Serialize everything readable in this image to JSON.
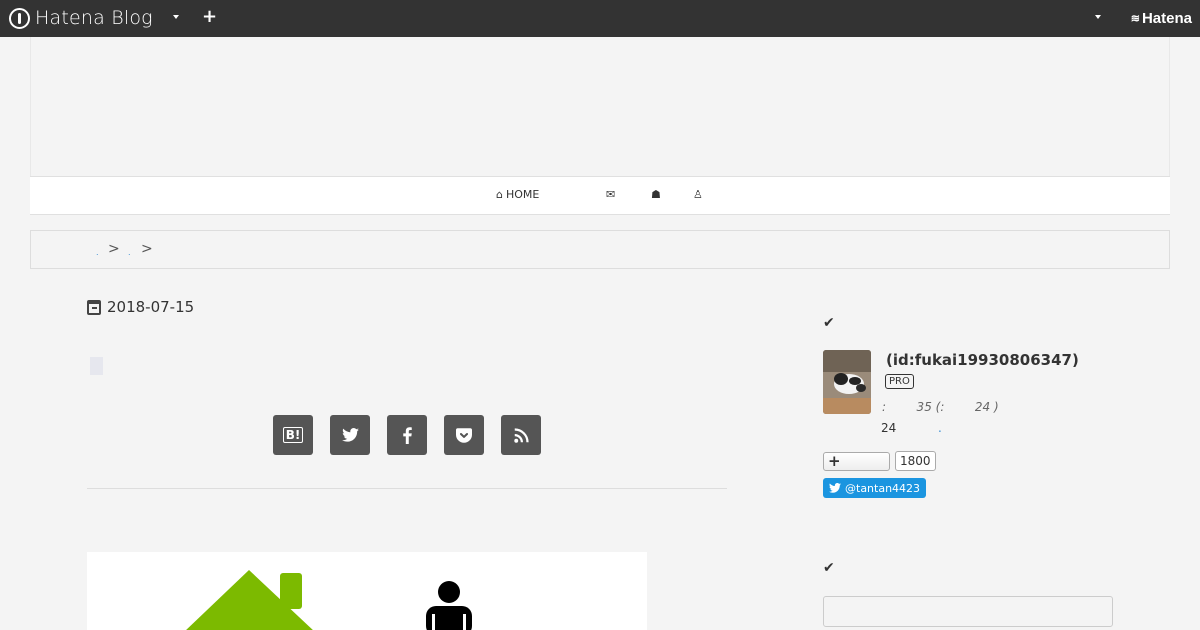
{
  "topbar": {
    "logo_text": "Hatena Blog",
    "add_label": "+",
    "brand_text": "Hatena",
    "brand_mark": "≋"
  },
  "nav": {
    "home_icon": "⌂",
    "home_label": "HOME",
    "mail_icon": "✉",
    "user_icon": "☗",
    "person_icon": "♙"
  },
  "breadcrumb": {
    "link1": ".",
    "sep1": ">",
    "link2": ".",
    "sep2": ">"
  },
  "entry": {
    "date": "2018-07-15"
  },
  "share": {
    "hatebu_label": "B!"
  },
  "sidebar": {
    "section1_check": "✔",
    "profile_name": "(id:fukai19930806347)",
    "pro_badge": "PRO",
    "stats_text": ":        35 (:        24 )",
    "count_text": "24",
    "dot_link": ".",
    "follow_plus": "+",
    "follow_count": "1800",
    "twitter_label": "@tantan4423",
    "section2_check": "✔"
  },
  "colors": {
    "topbar_bg": "#333333",
    "link_blue": "#3b8fd4",
    "twitter_blue": "#1b95e0",
    "house_green": "#7cba00"
  }
}
